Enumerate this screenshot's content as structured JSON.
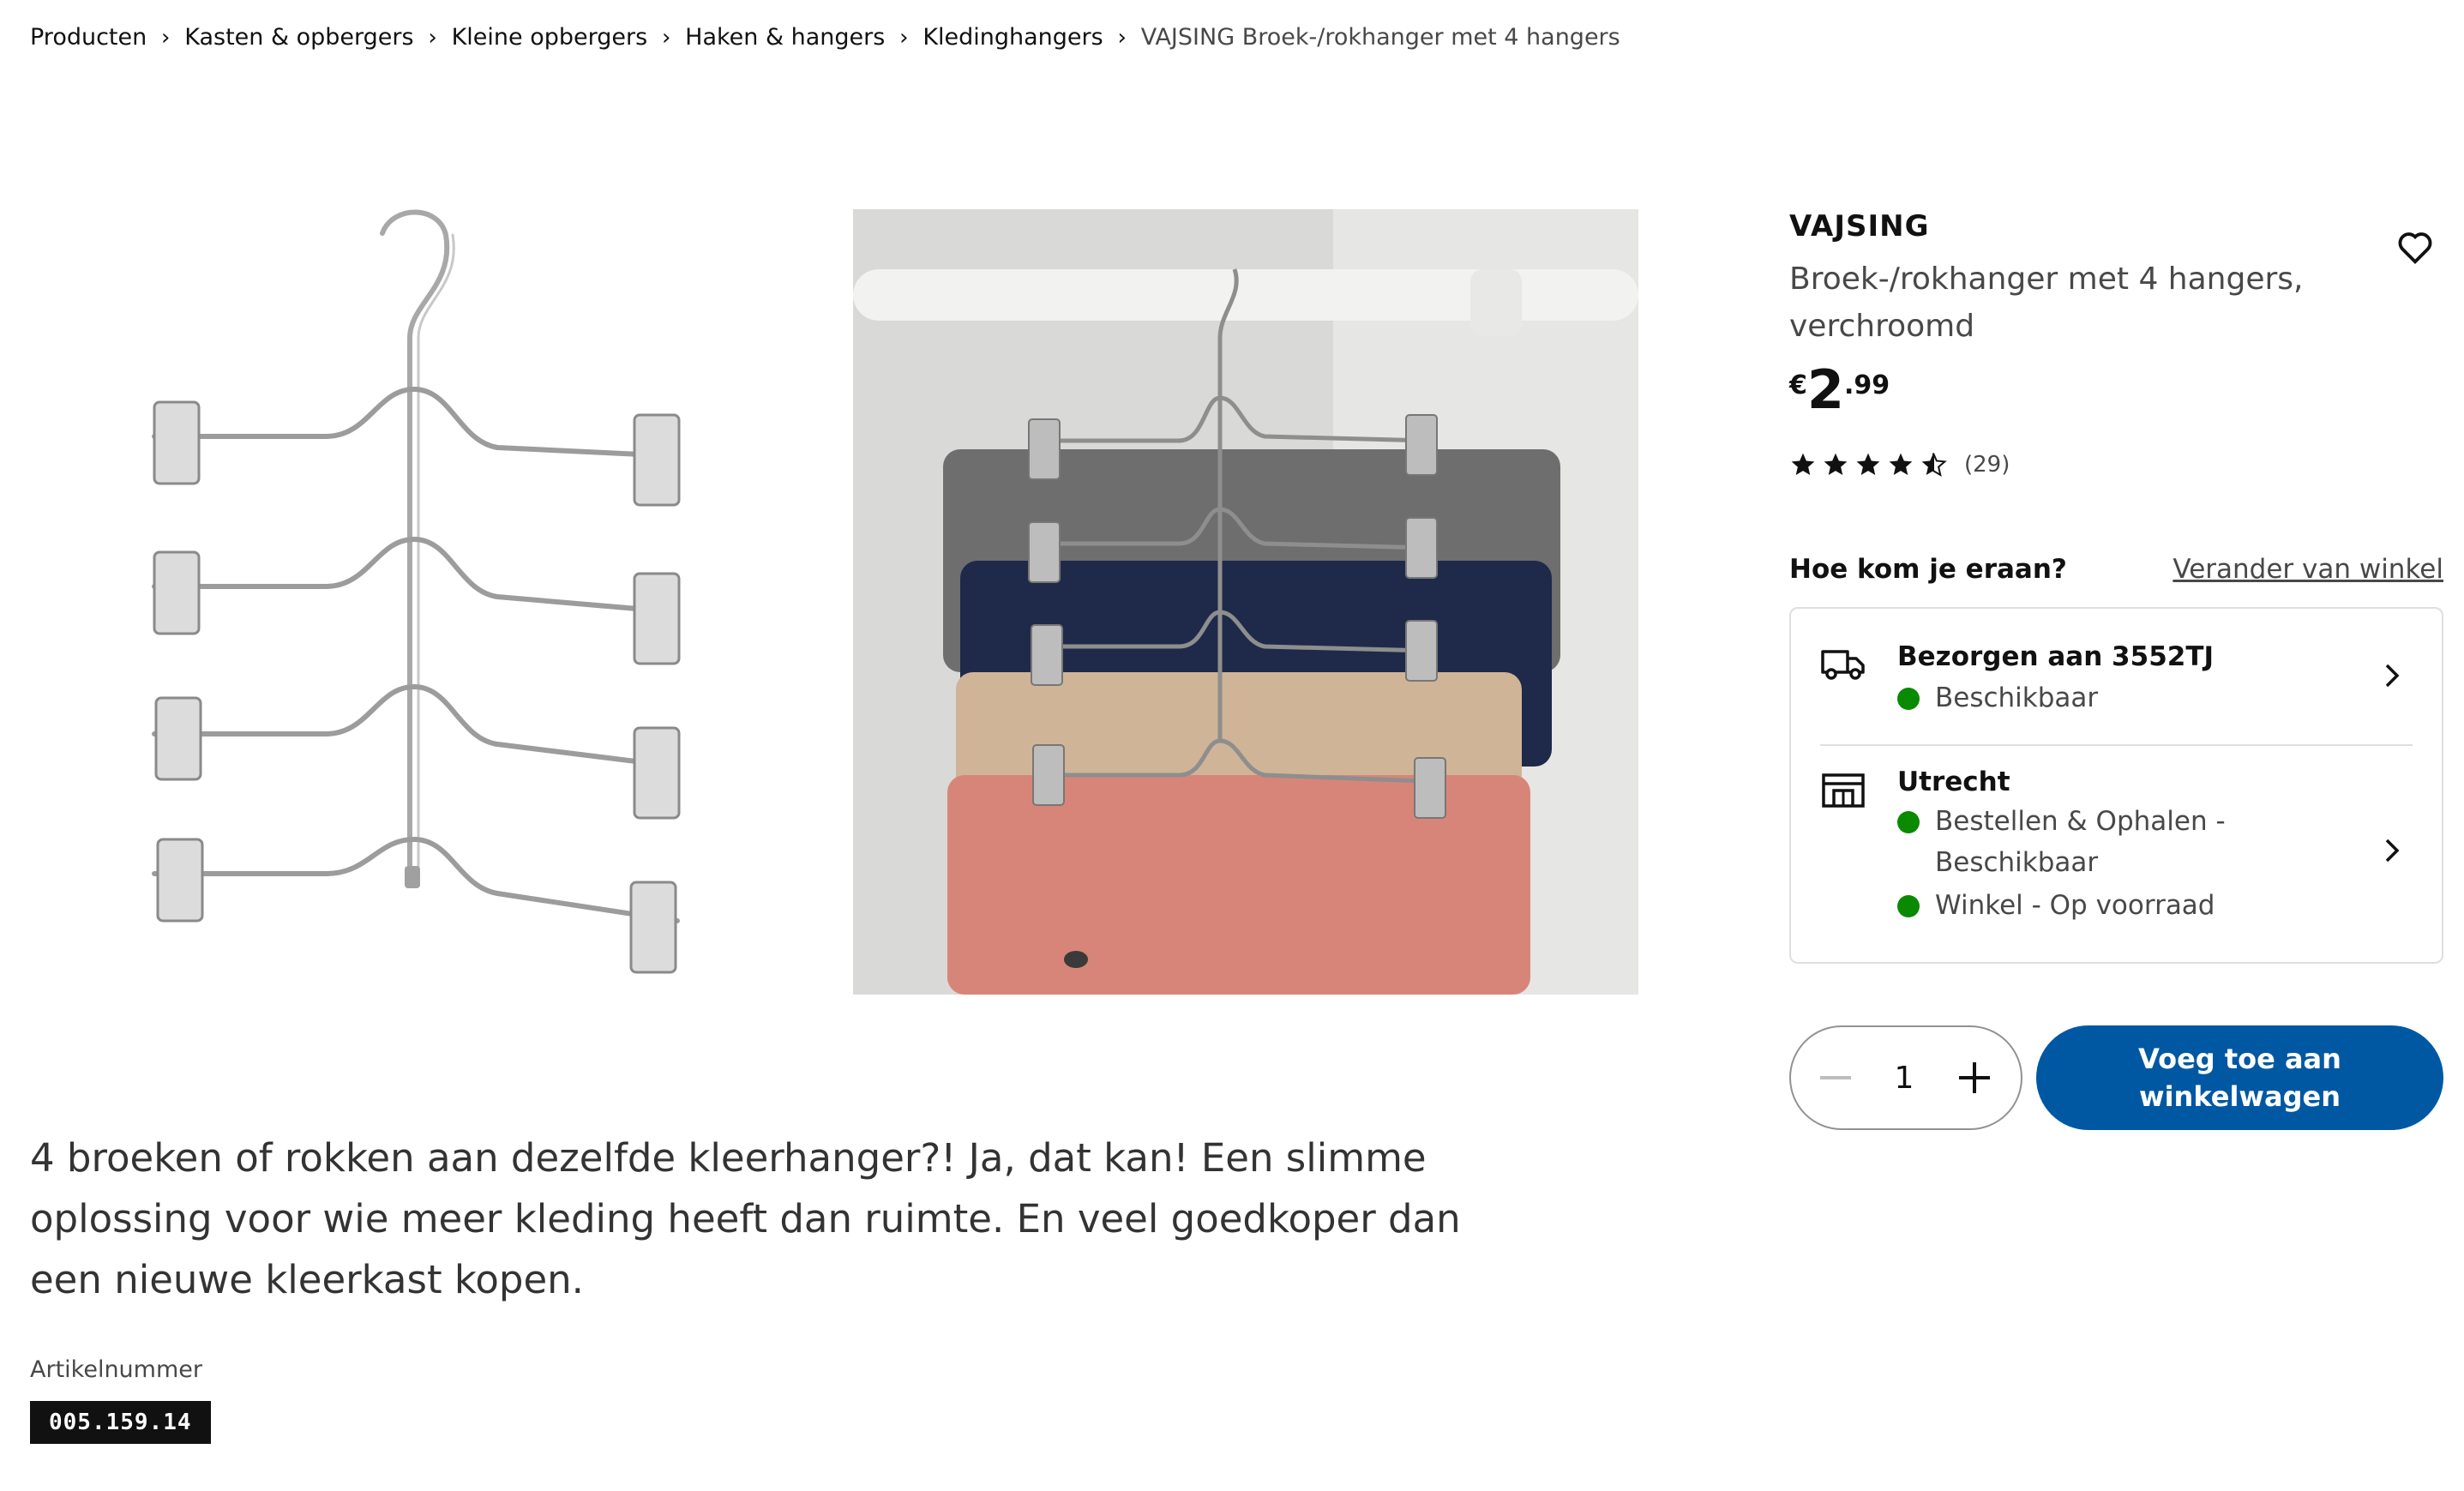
{
  "breadcrumb": {
    "items": [
      "Producten",
      "Kasten & opbergers",
      "Kleine opbergers",
      "Haken & hangers",
      "Kledinghangers"
    ],
    "current": "VAJSING Broek-/rokhanger met 4 hangers",
    "separator": "›"
  },
  "product": {
    "brand": "VAJSING",
    "subtitle": "Broek-/rokhanger met 4 hangers, verchroomd",
    "price": {
      "currency": "€",
      "integer": "2",
      "decimals": ".99"
    },
    "rating": {
      "value": 4.5,
      "max": 5,
      "count": "(29)"
    },
    "description": "4 broeken of rokken aan dezelfde kleerhanger?! Ja, dat kan! Een slimme oplossing voor wie meer kleding heeft dan ruimte. En veel goedkoper dan een nieuwe kleerkast kopen.",
    "article_label": "Artikelnummer",
    "article_number": "005.159.14"
  },
  "availability": {
    "title": "Hoe kom je eraan?",
    "change_store": "Verander van winkel",
    "delivery": {
      "title": "Bezorgen aan 3552TJ",
      "status": "Beschikbaar",
      "icon": "truck-icon"
    },
    "store": {
      "title": "Utrecht",
      "line1": "Bestellen & Ophalen - Beschikbaar",
      "line2": "Winkel - Op voorraad",
      "icon": "store-icon"
    },
    "status_color": "#0a8a00"
  },
  "purchase": {
    "quantity": "1",
    "add_to_cart": "Voeg toe aan winkelwagen",
    "accent": "#0058a3"
  }
}
